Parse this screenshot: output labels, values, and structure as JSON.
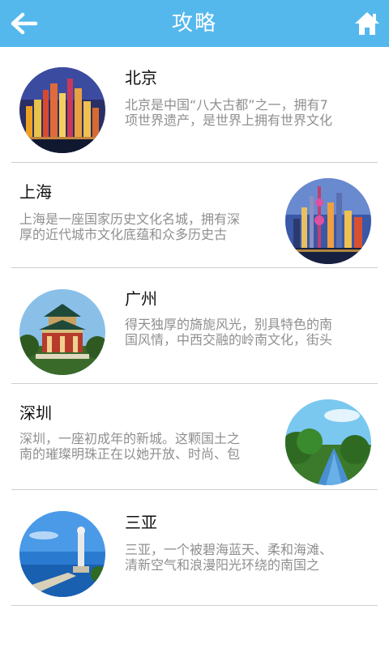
{
  "header": {
    "title": "攻略",
    "bg_color": "#55b8ec",
    "back_icon": "back-arrow-icon",
    "home_icon": "home-icon"
  },
  "cities": [
    {
      "name": "北京",
      "desc_lines": [
        "北京是中国“八大古都”之一，拥有7",
        "项世界遗产，是世界上拥有世界文化"
      ],
      "image": "beijing-night-skyline-photo"
    },
    {
      "name": "上海",
      "desc_lines": [
        "上海是一座国家历史文化名城，拥有深",
        "厚的近代城市文化底蕴和众多历史古"
      ],
      "image": "shanghai-night-skyline-photo"
    },
    {
      "name": "广州",
      "desc_lines": [
        "得天独厚的旖旎风光，别具特色的南",
        "国风情，中西交融的岭南文化，街头"
      ],
      "image": "guangzhou-memorial-hall-photo"
    },
    {
      "name": "深圳",
      "desc_lines": [
        "深圳，一座初成年的新城。这颗国土之",
        "南的璀璨明珠正在以她开放、时尚、包"
      ],
      "image": "shenzhen-mangrove-river-photo"
    },
    {
      "name": "三亚",
      "desc_lines": [
        "三亚，一个被碧海蓝天、柔和海滩、",
        "清新空气和浪漫阳光环绕的南国之"
      ],
      "image": "sanya-guanyin-statue-photo"
    }
  ]
}
